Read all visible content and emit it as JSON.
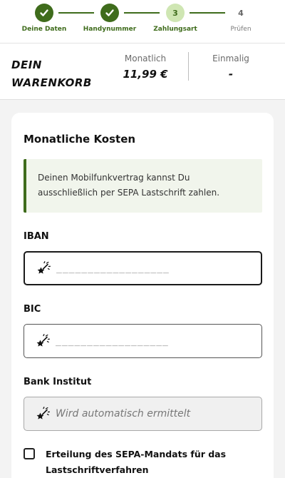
{
  "stepper": {
    "steps": [
      {
        "label": "Deine Daten",
        "state": "done",
        "marker": "✔"
      },
      {
        "label": "Handynummer",
        "state": "done",
        "marker": "✔"
      },
      {
        "label": "Zahlungsart",
        "state": "current",
        "marker": "3"
      },
      {
        "label": "Prüfen",
        "state": "todo",
        "marker": "4"
      }
    ]
  },
  "cart": {
    "title": "DEIN WARENKORB",
    "monthly_label": "Monatlich",
    "monthly_value": "11,99 €",
    "onetime_label": "Einmalig",
    "onetime_value": "-"
  },
  "payment": {
    "heading": "Monatliche Kosten",
    "info_text": "Deinen Mobilfunkvertrag kannst Du ausschließlich per SEPA Lastschrift zahlen.",
    "iban_label": "IBAN",
    "iban_placeholder": "__________________",
    "bic_label": "BIC",
    "bic_placeholder": "__________________",
    "bank_label": "Bank Institut",
    "bank_placeholder": "Wird automatisch ermittelt",
    "mandate_label": "Erteilung des SEPA-Mandats für das Lastschriftverfahren",
    "mandate_checked": false
  },
  "colors": {
    "accent": "#3f6c1c",
    "accent_light": "#cfe6b3",
    "info_bg": "#f1f5ec"
  },
  "icons": {
    "step_done": "checkmark-icon",
    "field": "magic-wand-icon"
  }
}
